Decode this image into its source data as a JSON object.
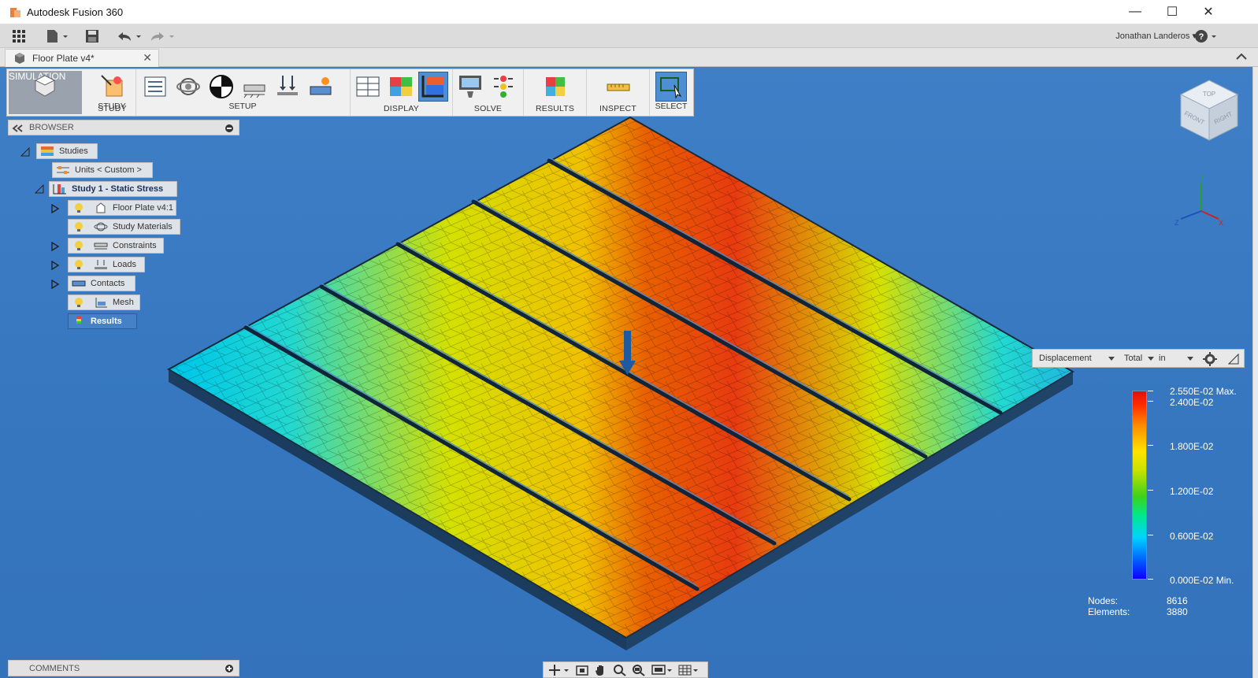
{
  "window": {
    "title": "Autodesk Fusion 360",
    "minimize": "—",
    "maximize": "☐",
    "close": "✕"
  },
  "user": {
    "name": "Jonathan Landeros ▾",
    "help": "?"
  },
  "document_tab": {
    "label": "Floor Plate v4*",
    "close": "✕"
  },
  "ribbon": {
    "workspace": "SIMULATION",
    "groups": [
      {
        "label": "STUDY"
      },
      {
        "label": "SETUP"
      },
      {
        "label": "DISPLAY"
      },
      {
        "label": "SOLVE"
      },
      {
        "label": "RESULTS"
      },
      {
        "label": "INSPECT"
      },
      {
        "label": "SELECT"
      }
    ]
  },
  "browser": {
    "title": "BROWSER",
    "nodes": [
      {
        "label": "Studies",
        "icon": "studies-icon"
      },
      {
        "label": "Units < Custom >",
        "icon": "units-icon"
      },
      {
        "label": "Study 1 - Static Stress",
        "icon": "study-icon"
      },
      {
        "label": "Floor Plate v4:1",
        "icon": "component-icon"
      },
      {
        "label": "Study Materials",
        "icon": "materials-icon"
      },
      {
        "label": "Constraints",
        "icon": "constraints-icon"
      },
      {
        "label": "Loads",
        "icon": "loads-icon"
      },
      {
        "label": "Contacts",
        "icon": "contacts-icon"
      },
      {
        "label": "Mesh",
        "icon": "mesh-icon"
      },
      {
        "label": "Results",
        "icon": "results-icon"
      }
    ]
  },
  "comments": {
    "title": "COMMENTS"
  },
  "results_toolbar": {
    "result_type": "Displacement",
    "component": "Total",
    "unit": "in"
  },
  "legend": {
    "max_label": "2.550E-02 Max.",
    "ticks": [
      "2.400E-02",
      "1.800E-02",
      "1.200E-02",
      "0.600E-02"
    ],
    "min_label": "0.000E-02 Min.",
    "colors": [
      "#1000ff",
      "#00d4ff",
      "#3ed21a",
      "#ffe400",
      "#ff8a00",
      "#e01010"
    ]
  },
  "stats": {
    "nodes_label": "Nodes:",
    "nodes_value": "8616",
    "elements_label": "Elements:",
    "elements_value": "3880"
  },
  "view_cube": {
    "top": "TOP",
    "front": "FRONT",
    "right": "RIGHT"
  },
  "axes": {
    "x": "X",
    "y": "Y",
    "z": "Z"
  },
  "colors": {
    "viewport": "#3677c0",
    "ribbon": "#f0f0f0",
    "accent": "#4a90d9"
  }
}
